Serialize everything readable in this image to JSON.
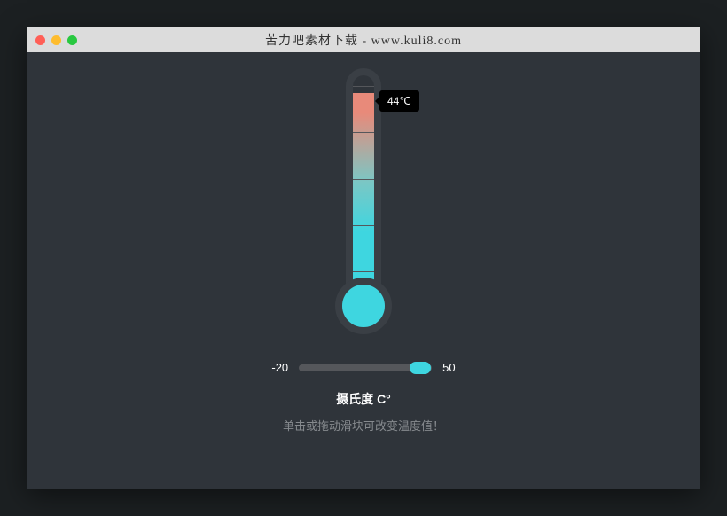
{
  "titlebar": {
    "title": "苦力吧素材下载 - www.kuli8.com"
  },
  "thermometer": {
    "tooltip": "44℃",
    "value": 44
  },
  "slider": {
    "min_label": "-20",
    "max_label": "50",
    "min": -20,
    "max": 50,
    "value": 44
  },
  "labels": {
    "unit": "摄氏度 C°",
    "hint": "单击或拖动滑块可改变温度值！"
  }
}
